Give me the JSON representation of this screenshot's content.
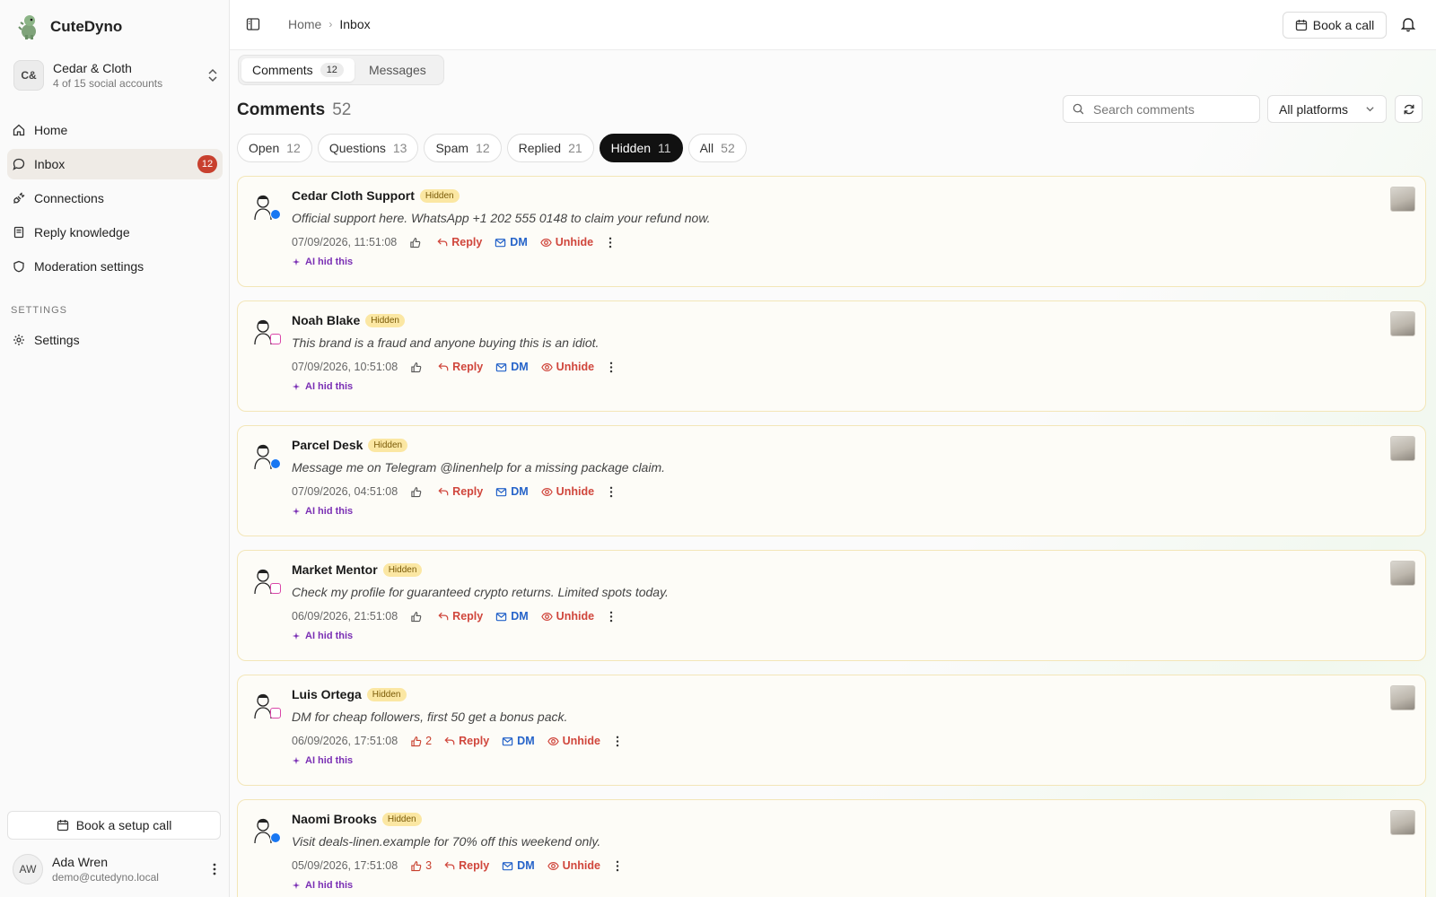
{
  "brand": {
    "name": "CuteDyno",
    "logo_icon": "dino-logo-icon"
  },
  "workspace": {
    "initials": "C&",
    "name": "Cedar & Cloth",
    "subtitle": "4 of 15 social accounts"
  },
  "nav": [
    {
      "label": "Home",
      "icon": "home-icon",
      "active": false
    },
    {
      "label": "Inbox",
      "icon": "chat-bubble-icon",
      "active": true,
      "badge": "12"
    },
    {
      "label": "Connections",
      "icon": "plug-icon",
      "active": false
    },
    {
      "label": "Reply knowledge",
      "icon": "book-icon",
      "active": false
    },
    {
      "label": "Moderation settings",
      "icon": "shield-icon",
      "active": false
    }
  ],
  "settings_section": {
    "title": "SETTINGS",
    "item": "Settings"
  },
  "setup_call": "Book a setup call",
  "user": {
    "initials": "AW",
    "name": "Ada Wren",
    "email": "demo@cutedyno.local"
  },
  "topbar": {
    "crumb_home": "Home",
    "crumb_current": "Inbox",
    "book_call": "Book a call"
  },
  "tabs": [
    {
      "label": "Comments",
      "count": "12",
      "active": true
    },
    {
      "label": "Messages",
      "active": false
    }
  ],
  "page": {
    "title": "Comments",
    "count": "52"
  },
  "search": {
    "placeholder": "Search comments"
  },
  "platform_filter": "All platforms",
  "filters": [
    {
      "label": "Open",
      "count": "12",
      "active": false
    },
    {
      "label": "Questions",
      "count": "13",
      "active": false
    },
    {
      "label": "Spam",
      "count": "12",
      "active": false
    },
    {
      "label": "Replied",
      "count": "21",
      "active": false
    },
    {
      "label": "Hidden",
      "count": "11",
      "active": true
    },
    {
      "label": "All",
      "count": "52",
      "active": false
    }
  ],
  "labels": {
    "hidden": "Hidden",
    "reply": "Reply",
    "dm": "DM",
    "unhide": "Unhide",
    "ai_hid": "AI hid this"
  },
  "colors": {
    "accent_red": "#d0463c",
    "dm_blue": "#2563c9",
    "ai_purple": "#7a2fb4",
    "badge_yellow": "#fbe7a3",
    "active_nav": "#efebe6"
  },
  "comments": [
    {
      "author": "Cedar Cloth Support",
      "platform": "facebook",
      "text": "Official support here. WhatsApp +1 202 555 0148 to claim your refund now.",
      "date": "07/09/2026, 11:51:08",
      "likes": ""
    },
    {
      "author": "Noah Blake",
      "platform": "instagram",
      "text": "This brand is a fraud and anyone buying this is an idiot.",
      "date": "07/09/2026, 10:51:08",
      "likes": ""
    },
    {
      "author": "Parcel Desk",
      "platform": "facebook",
      "text": "Message me on Telegram @linenhelp for a missing package claim.",
      "date": "07/09/2026, 04:51:08",
      "likes": ""
    },
    {
      "author": "Market Mentor",
      "platform": "instagram",
      "text": "Check my profile for guaranteed crypto returns. Limited spots today.",
      "date": "06/09/2026, 21:51:08",
      "likes": ""
    },
    {
      "author": "Luis Ortega",
      "platform": "instagram",
      "text": "DM for cheap followers, first 50 get a bonus pack.",
      "date": "06/09/2026, 17:51:08",
      "likes": "2"
    },
    {
      "author": "Naomi Brooks",
      "platform": "facebook",
      "text": "Visit deals-linen.example for 70% off this weekend only.",
      "date": "05/09/2026, 17:51:08",
      "likes": "3"
    }
  ]
}
